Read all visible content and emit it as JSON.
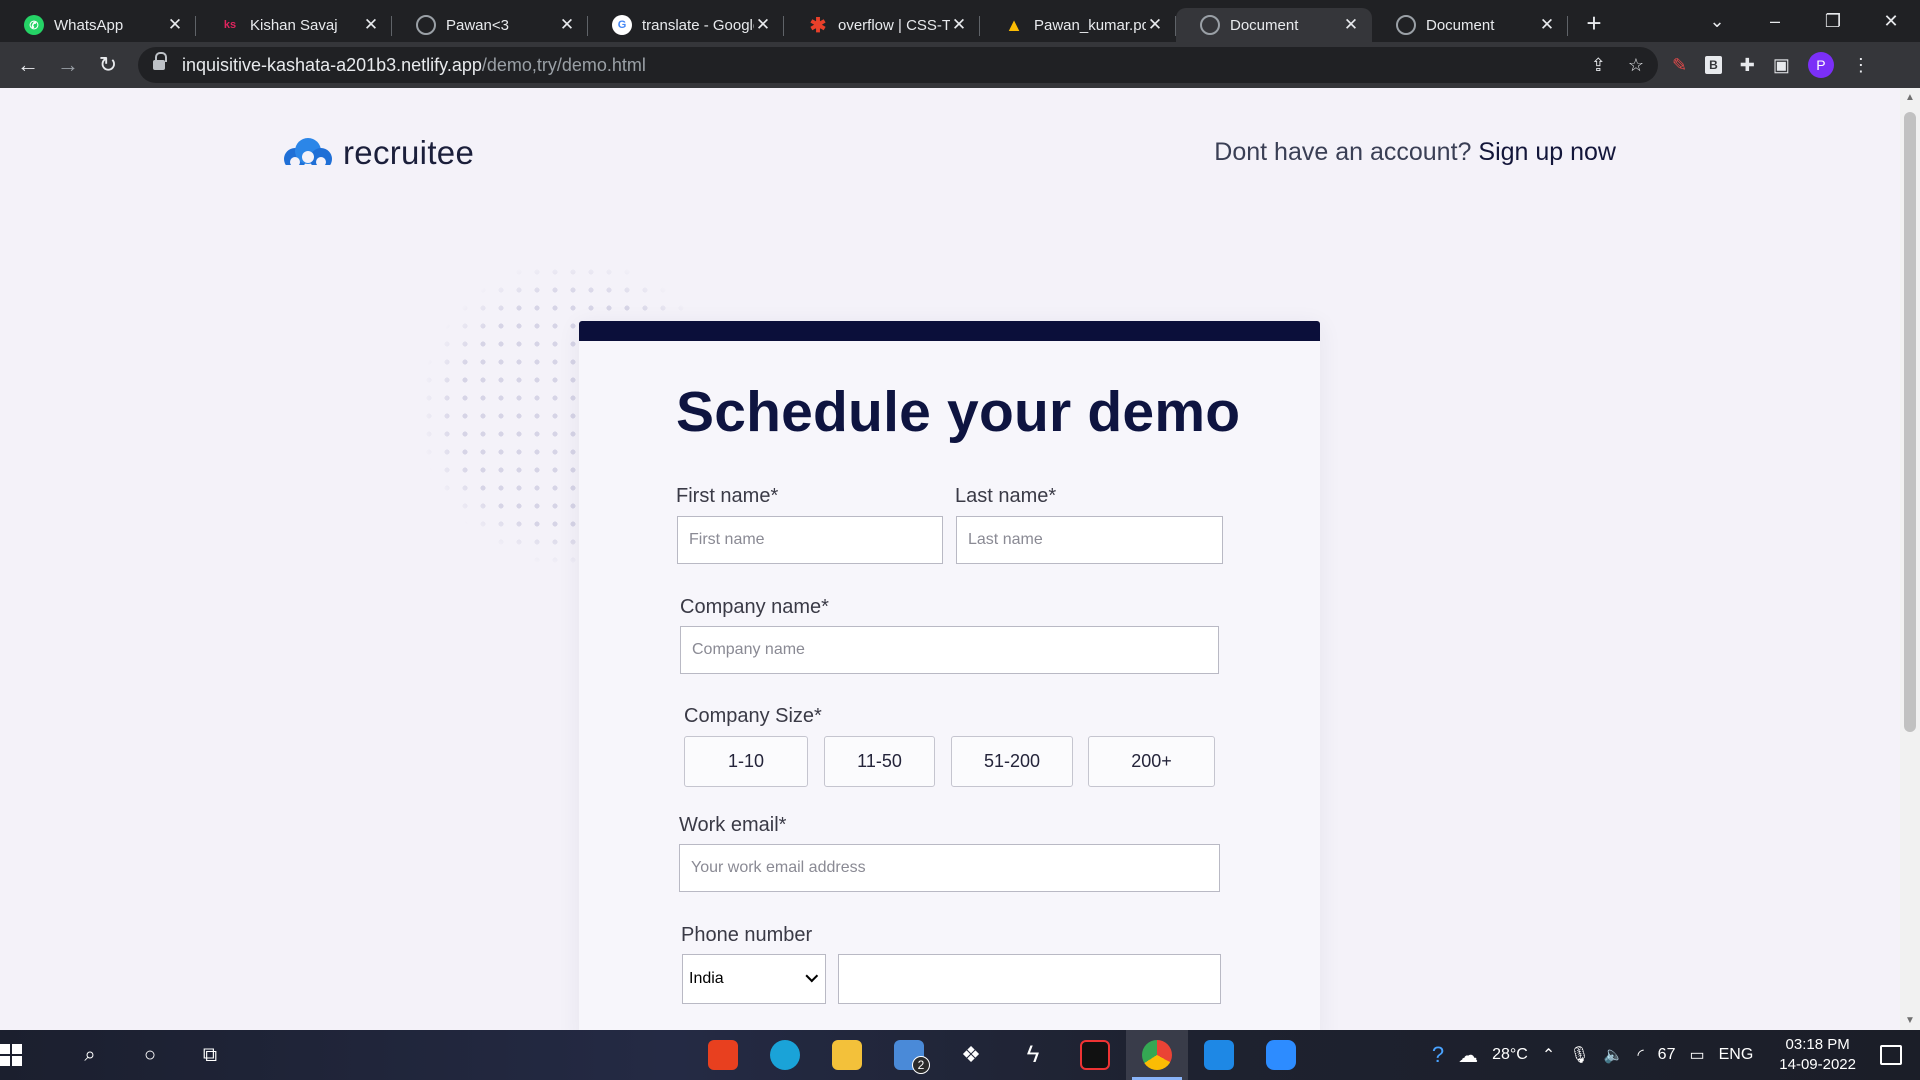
{
  "tabs": [
    {
      "title": "WhatsApp",
      "icon": "whatsapp-icon",
      "color": "#25d366"
    },
    {
      "title": "Kishan Savaj",
      "icon": "ks-icon",
      "color": "#e0245e"
    },
    {
      "title": "Pawan<3",
      "icon": "globe-icon",
      "color": "#9aa0a6"
    },
    {
      "title": "translate - Google",
      "icon": "google-icon",
      "color": "#4285f4"
    },
    {
      "title": "overflow | CSS-Tri",
      "icon": "css-tricks-icon",
      "color": "#e8402a"
    },
    {
      "title": "Pawan_kumar.pdf",
      "icon": "google-drive-icon",
      "color": "#fbbc04"
    },
    {
      "title": "Document",
      "icon": "globe-icon",
      "color": "#9aa0a6"
    },
    {
      "title": "Document",
      "icon": "globe-icon",
      "color": "#9aa0a6"
    }
  ],
  "browser": {
    "url_host": "inquisitive-kashata-a201b3.netlify.app",
    "url_path": "/demo,try/demo.html",
    "profile_initial": "P"
  },
  "page": {
    "logo_text": "recruitee",
    "signup_prompt": "Dont have an account?",
    "signup_link": "Sign up now",
    "heading": "Schedule your demo",
    "first_name_label": "First name*",
    "first_name_placeholder": "First name",
    "last_name_label": "Last name*",
    "last_name_placeholder": "Last name",
    "company_label": "Company name*",
    "company_placeholder": "Company name",
    "size_label": "Company Size*",
    "size_options": [
      "1-10",
      "11-50",
      "51-200",
      "200+"
    ],
    "email_label": "Work email*",
    "email_placeholder": "Your work email address",
    "phone_label": "Phone number",
    "country_selected": "India",
    "brand_color": "#1f6fd6",
    "accent_dark": "#0b0f3a"
  },
  "taskbar": {
    "mail_badge": "2",
    "weather": "28°C",
    "battery": "67",
    "language": "ENG",
    "time": "03:18 PM",
    "date": "14-09-2022"
  }
}
